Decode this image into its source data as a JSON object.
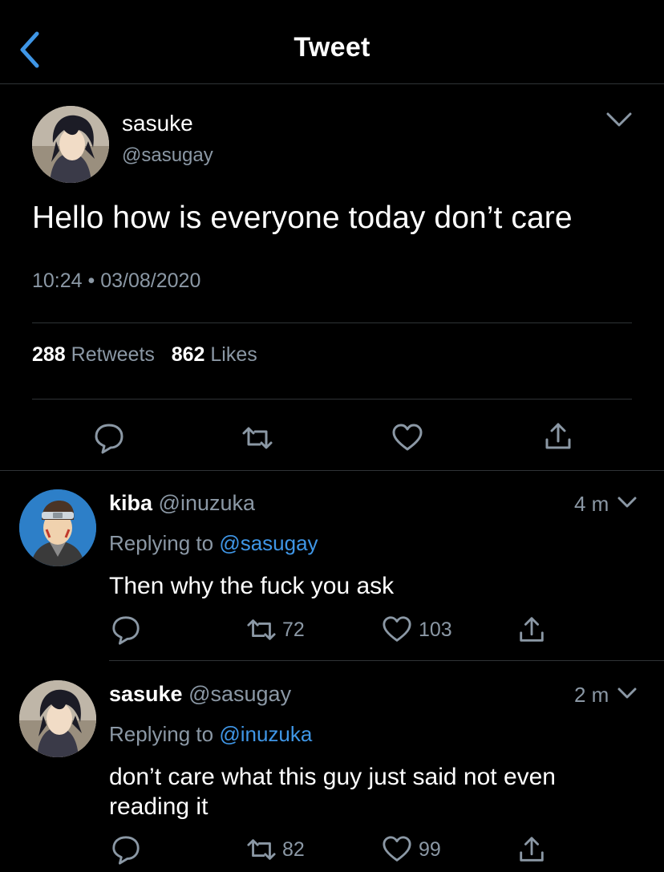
{
  "header": {
    "title": "Tweet"
  },
  "tweet": {
    "author_name": "sasuke",
    "author_handle": "@sasugay",
    "text": "Hello how is everyone today don’t care",
    "time": "10:24",
    "separator": "•",
    "date": "03/08/2020",
    "retweets_count": "288",
    "retweets_label": "Retweets",
    "likes_count": "862",
    "likes_label": "Likes"
  },
  "replies": [
    {
      "name": "kiba",
      "handle": "@inuzuka",
      "age": "4 m",
      "replying_prefix": "Replying to",
      "replying_to": "@sasugay",
      "text": "Then why the fuck you ask",
      "retweets": "72",
      "likes": "103"
    },
    {
      "name": "sasuke",
      "handle": "@sasugay",
      "age": "2 m",
      "replying_prefix": "Replying to",
      "replying_to": "@inuzuka",
      "text_line1": "don’t care what this guy just said not even",
      "text_line2": "reading it",
      "retweets": "82",
      "likes": "99"
    }
  ],
  "colors": {
    "accent": "#3f96e6",
    "muted": "#8b98a5",
    "divider": "#2f3336",
    "background": "#000000"
  },
  "icons": [
    "chevron-left-icon",
    "chevron-down-icon",
    "reply-icon",
    "retweet-icon",
    "like-icon",
    "share-icon"
  ]
}
